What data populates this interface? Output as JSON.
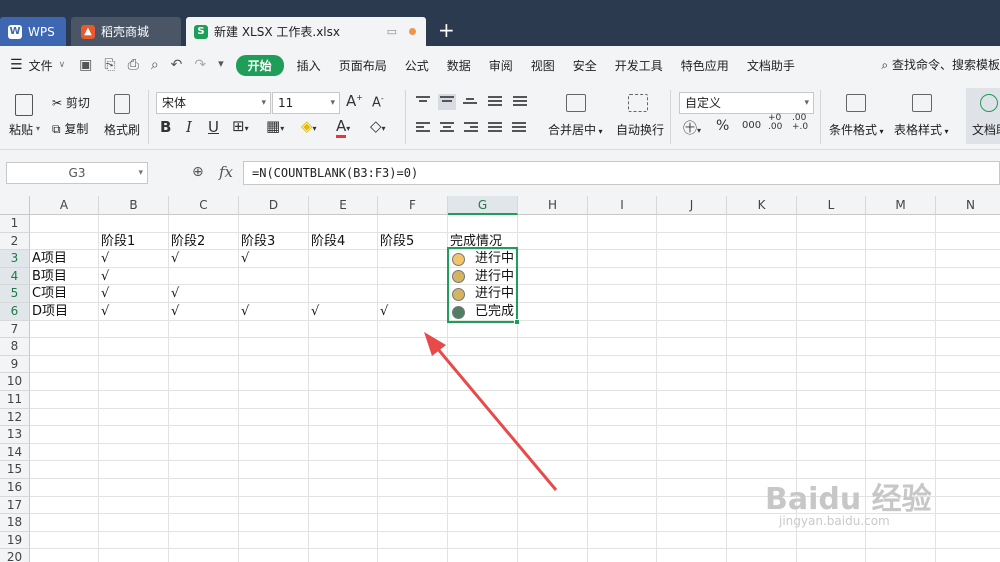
{
  "tabs": {
    "wps": "WPS",
    "shop": "稻壳商城",
    "document": "新建 XLSX 工作表.xlsx"
  },
  "menu": {
    "file": "文件",
    "items": [
      "开始",
      "插入",
      "页面布局",
      "公式",
      "数据",
      "审阅",
      "视图",
      "安全",
      "开发工具",
      "特色应用",
      "文档助手"
    ],
    "search": "查找命令、搜索模板"
  },
  "ribbon": {
    "paste": "粘贴",
    "cut": "剪切",
    "copy": "复制",
    "format_painter": "格式刷",
    "font_name": "宋体",
    "font_size": "11",
    "merge_center": "合并居中",
    "wrap_text": "自动换行",
    "number_format": "自定义",
    "conditional_format": "条件格式",
    "table_style": "表格样式",
    "doc_helper": "文档助"
  },
  "formula_bar": {
    "name_box": "G3",
    "formula": "=N(COUNTBLANK(B3:F3)=0)"
  },
  "columns": [
    "A",
    "B",
    "C",
    "D",
    "E",
    "F",
    "G",
    "H",
    "I",
    "J",
    "K",
    "L",
    "M",
    "N"
  ],
  "rows": [
    "1",
    "2",
    "3",
    "4",
    "5",
    "6",
    "7",
    "8",
    "9",
    "10",
    "11",
    "12",
    "13",
    "14",
    "15",
    "16",
    "17",
    "18",
    "19",
    "20"
  ],
  "sheet": {
    "headers": [
      "阶段1",
      "阶段2",
      "阶段3",
      "阶段4",
      "阶段5",
      "完成情况"
    ],
    "projects": [
      {
        "name": "A项目",
        "marks": [
          "√",
          "√",
          "√",
          "",
          ""
        ],
        "status": "进行中",
        "status_color": "#f2c46b"
      },
      {
        "name": "B项目",
        "marks": [
          "√",
          "",
          "",
          "",
          ""
        ],
        "status": "进行中",
        "status_color": "#d4b462"
      },
      {
        "name": "C项目",
        "marks": [
          "√",
          "√",
          "",
          "",
          ""
        ],
        "status": "进行中",
        "status_color": "#d4b462"
      },
      {
        "name": "D项目",
        "marks": [
          "√",
          "√",
          "√",
          "√",
          "√"
        ],
        "status": "已完成",
        "status_color": "#4f7f62"
      }
    ]
  },
  "watermark": {
    "main": "Baidu 经验",
    "sub": "jingyan.baidu.com"
  },
  "colors": {
    "accent": "#1e9e58",
    "tabbar": "#2b3a4e",
    "arrow": "#e84a4a"
  }
}
